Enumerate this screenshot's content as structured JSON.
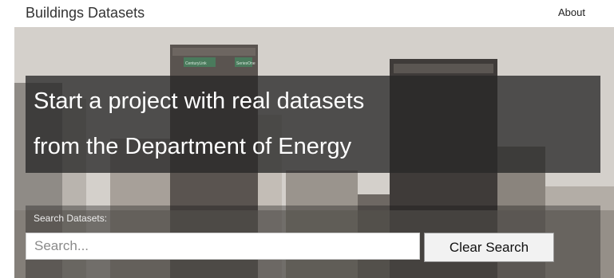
{
  "navbar": {
    "brand": "Buildings Datasets",
    "about_label": "About"
  },
  "hero": {
    "headline_line1": "Start a project with real datasets",
    "headline_line2": "from the Department of Energy",
    "background": "city-skyline-photo",
    "sign_left": "CenturyLink",
    "sign_right": "SeriesOne"
  },
  "search": {
    "label": "Search Datasets:",
    "placeholder": "Search...",
    "value": "",
    "clear_label": "Clear Search"
  }
}
